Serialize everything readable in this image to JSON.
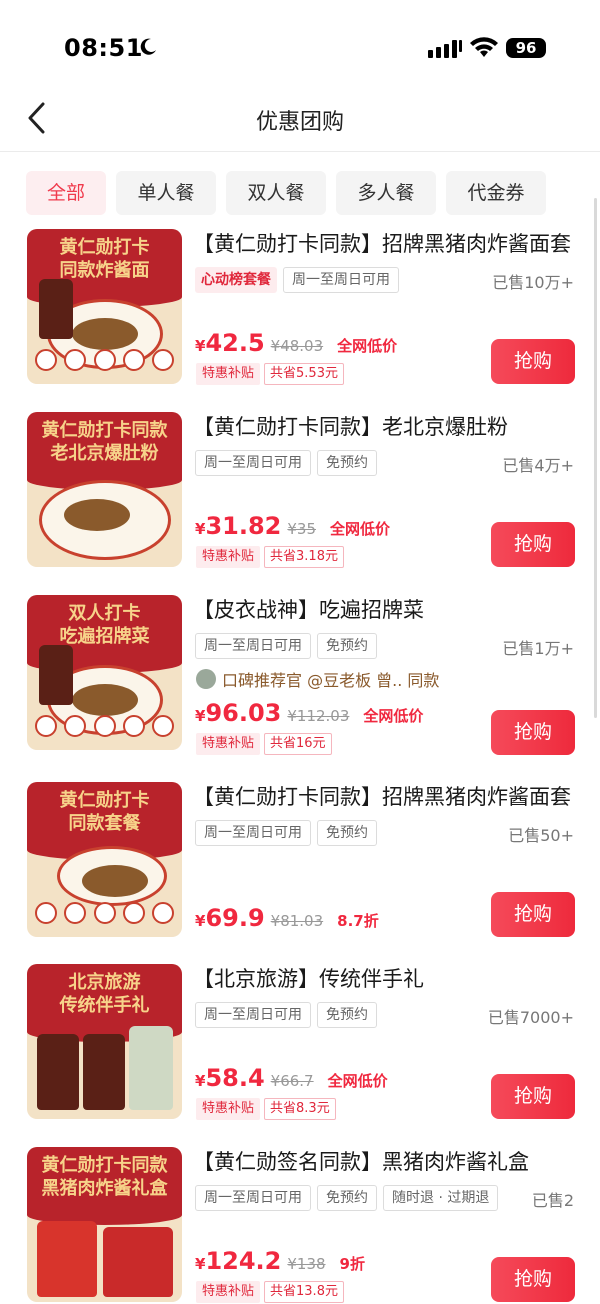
{
  "status_bar": {
    "time": "08:51",
    "battery": "96"
  },
  "nav": {
    "title": "优惠团购"
  },
  "filters": [
    {
      "label": "全部",
      "active": true
    },
    {
      "label": "单人餐",
      "active": false
    },
    {
      "label": "双人餐",
      "active": false
    },
    {
      "label": "多人餐",
      "active": false
    },
    {
      "label": "代金券",
      "active": false
    }
  ],
  "deals": [
    {
      "image_caption": [
        "黄仁勋打卡",
        "同款炸酱面"
      ],
      "title": "【黄仁勋打卡同款】招牌黑猪肉炸酱面套",
      "brand_tag": "心动榜套餐",
      "tags": [
        "周一至周日可用"
      ],
      "sold": "已售10万+",
      "currency": "¥",
      "price": "42.5",
      "original_price": "¥48.03",
      "promo": "全网低价",
      "subsidy": "特惠补贴",
      "saving": "共省5.53元",
      "button": "抢购"
    },
    {
      "image_caption": [
        "黄仁勋打卡同款",
        "老北京爆肚粉"
      ],
      "title": "【黄仁勋打卡同款】老北京爆肚粉",
      "tags": [
        "周一至周日可用",
        "免预约"
      ],
      "sold": "已售4万+",
      "currency": "¥",
      "price": "31.82",
      "original_price": "¥35",
      "promo": "全网低价",
      "subsidy": "特惠补贴",
      "saving": "共省3.18元",
      "button": "抢购"
    },
    {
      "image_caption": [
        "双人打卡",
        "吃遍招牌菜"
      ],
      "title": "【皮衣战神】吃遍招牌菜",
      "tags": [
        "周一至周日可用",
        "免预约"
      ],
      "sold": "已售1万+",
      "recommend": "口碑推荐官 @豆老板 曾.. 同款",
      "currency": "¥",
      "price": "96.03",
      "original_price": "¥112.03",
      "promo": "全网低价",
      "subsidy": "特惠补贴",
      "saving": "共省16元",
      "button": "抢购"
    },
    {
      "image_caption": [
        "黄仁勋打卡",
        "同款套餐"
      ],
      "title": "【黄仁勋打卡同款】招牌黑猪肉炸酱面套",
      "tags": [
        "周一至周日可用",
        "免预约"
      ],
      "sold": "已售50+",
      "currency": "¥",
      "price": "69.9",
      "original_price": "¥81.03",
      "promo": "8.7折",
      "button": "抢购"
    },
    {
      "image_caption": [
        "北京旅游",
        "传统伴手礼"
      ],
      "title": "【北京旅游】传统伴手礼",
      "tags": [
        "周一至周日可用",
        "免预约"
      ],
      "sold": "已售7000+",
      "currency": "¥",
      "price": "58.4",
      "original_price": "¥66.7",
      "promo": "全网低价",
      "subsidy": "特惠补贴",
      "saving": "共省8.3元",
      "button": "抢购"
    },
    {
      "image_caption": [
        "黄仁勋打卡同款",
        "黑猪肉炸酱礼盒"
      ],
      "title": "【黄仁勋签名同款】黑猪肉炸酱礼盒",
      "tags": [
        "周一至周日可用",
        "免预约",
        "随时退 · 过期退"
      ],
      "sold": "已售2",
      "currency": "¥",
      "price": "124.2",
      "original_price": "¥138",
      "promo": "9折",
      "subsidy": "特惠补贴",
      "saving": "共省13.8元",
      "button": "抢购"
    }
  ],
  "colors": {
    "accent": "#f0283f",
    "button": "#f23a4a",
    "image_banner": "#b8232b"
  }
}
